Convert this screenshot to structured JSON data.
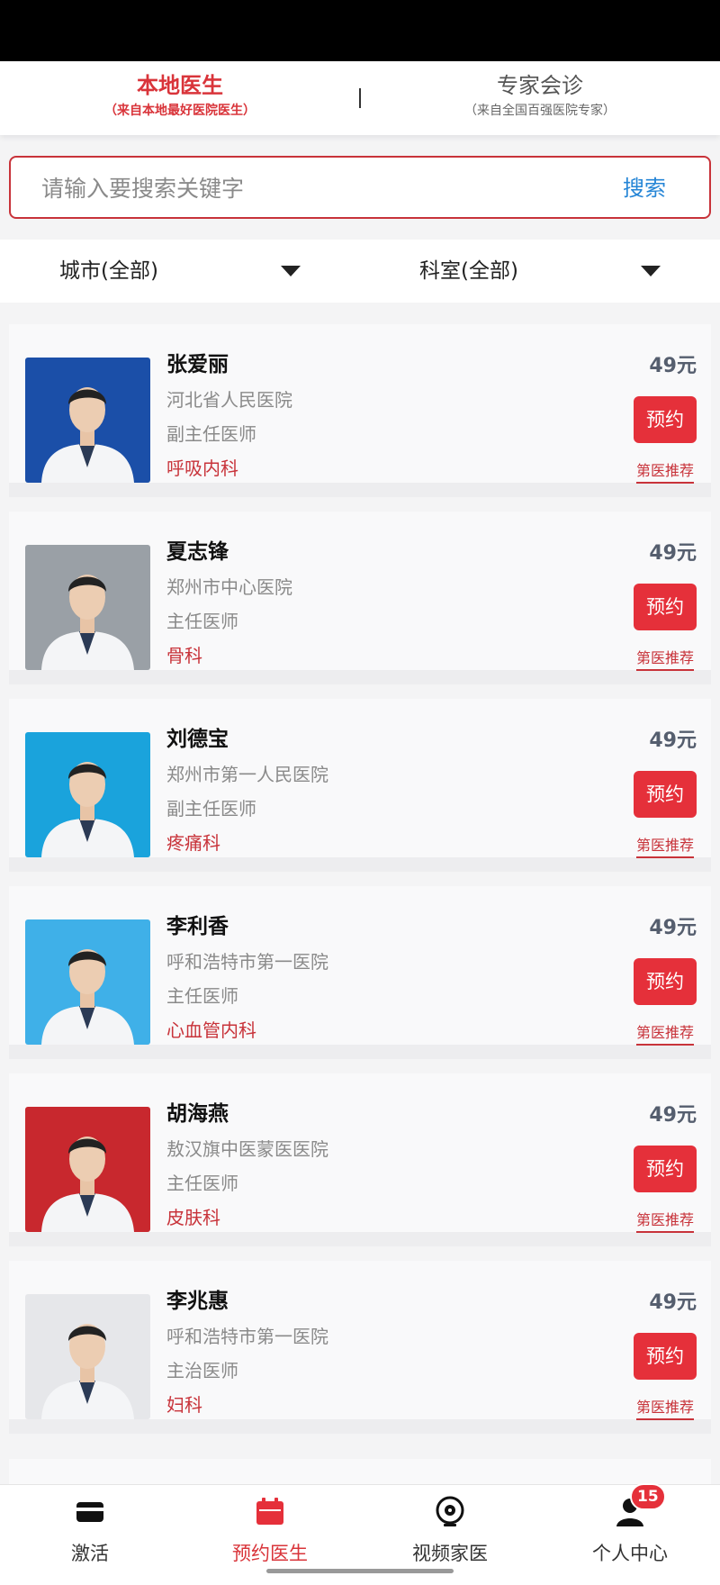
{
  "tabs": {
    "local": {
      "title": "本地医生",
      "subtitle": "（来自本地最好医院医生）"
    },
    "expert": {
      "title": "专家会诊",
      "subtitle": "（来自全国百强医院专家）"
    }
  },
  "search": {
    "placeholder": "请输入要搜索关键字",
    "value": "",
    "button_label": "搜索"
  },
  "filters": {
    "city": "城市(全部)",
    "department": "科室(全部)"
  },
  "doctors": [
    {
      "name": "张爱丽",
      "hospital": "河北省人民医院",
      "title": "副主任医师",
      "department": "呼吸内科",
      "price": "49元",
      "book_label": "预约",
      "recommend_label": "第医推荐"
    },
    {
      "name": "夏志锋",
      "hospital": "郑州市中心医院",
      "title": "主任医师",
      "department": "骨科",
      "price": "49元",
      "book_label": "预约",
      "recommend_label": "第医推荐"
    },
    {
      "name": "刘德宝",
      "hospital": "郑州市第一人民医院",
      "title": "副主任医师",
      "department": "疼痛科",
      "price": "49元",
      "book_label": "预约",
      "recommend_label": "第医推荐"
    },
    {
      "name": "李利香",
      "hospital": "呼和浩特市第一医院",
      "title": "主任医师",
      "department": "心血管内科",
      "price": "49元",
      "book_label": "预约",
      "recommend_label": "第医推荐"
    },
    {
      "name": "胡海燕",
      "hospital": "敖汉旗中医蒙医医院",
      "title": "主任医师",
      "department": "皮肤科",
      "price": "49元",
      "book_label": "预约",
      "recommend_label": "第医推荐"
    },
    {
      "name": "李兆惠",
      "hospital": "呼和浩特市第一医院",
      "title": "主治医师",
      "department": "妇科",
      "price": "49元",
      "book_label": "预约",
      "recommend_label": "第医推荐"
    }
  ],
  "photo_backgrounds": [
    "#1b4fa8",
    "#9aa0a6",
    "#1aa3dc",
    "#3fb0e8",
    "#c8282e",
    "#e6e7ea"
  ],
  "bottom_nav": {
    "items": [
      {
        "label": "激活",
        "icon": "card-icon"
      },
      {
        "label": "预约医生",
        "icon": "calendar-icon"
      },
      {
        "label": "视频家医",
        "icon": "webcam-icon"
      },
      {
        "label": "个人中心",
        "icon": "person-icon"
      }
    ],
    "active_index": 1,
    "badge_count": "15"
  },
  "colors": {
    "accent": "#d9343a",
    "link": "#2585d6",
    "button": "#e5303a"
  }
}
